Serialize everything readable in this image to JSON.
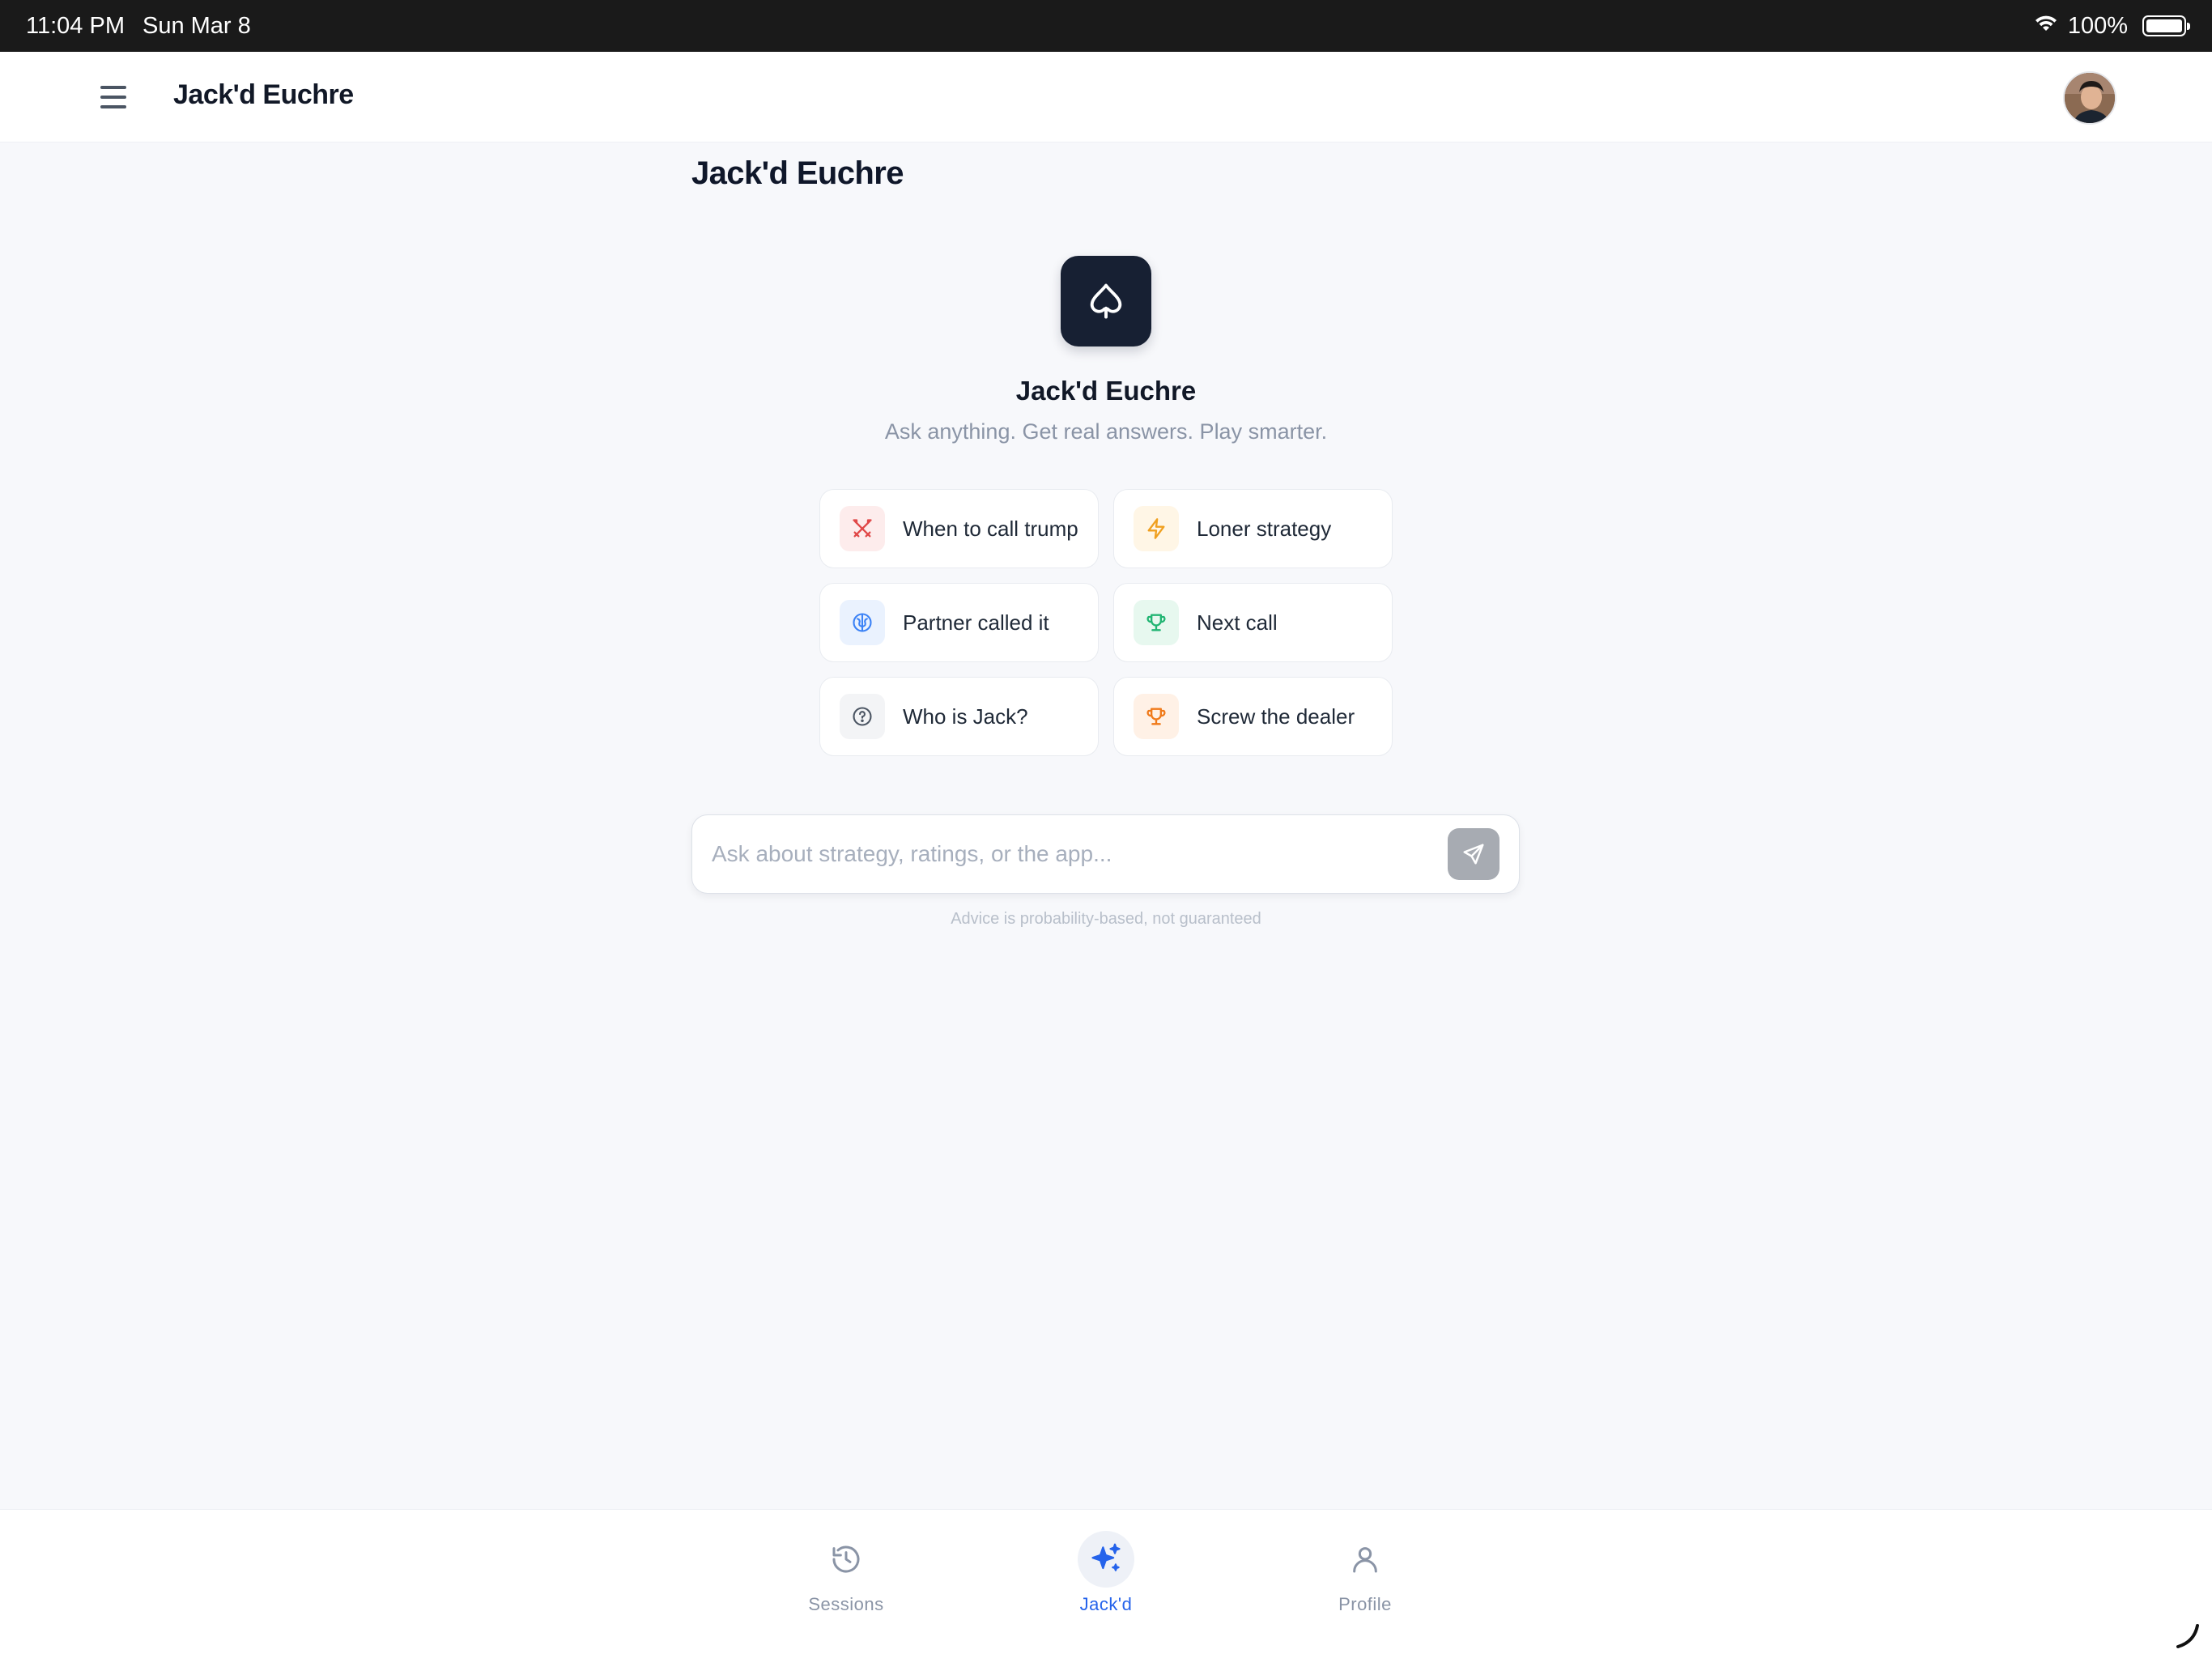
{
  "status_bar": {
    "time": "11:04 PM",
    "date": "Sun Mar 8",
    "battery": "100%",
    "battery_level": 1.0
  },
  "app_bar": {
    "title": "Jack'd Euchre",
    "menu_icon": "hamburger-menu-icon",
    "avatar_icon": "user-avatar"
  },
  "main": {
    "heading": "Jack'd Euchre",
    "hero": {
      "icon": "spade-icon",
      "title": "Jack'd Euchre",
      "subtitle": "Ask anything. Get real answers. Play smarter."
    },
    "prompts": [
      {
        "label": "When to call trump",
        "icon": "crossed-swords-icon",
        "color": "#e04848",
        "bg": "#fdecec"
      },
      {
        "label": "Loner strategy",
        "icon": "lightning-icon",
        "color": "#f0a020",
        "bg": "#fff6e6"
      },
      {
        "label": "Partner called it",
        "icon": "brain-icon",
        "color": "#3b82f6",
        "bg": "#eaf2fe"
      },
      {
        "label": "Next call",
        "icon": "trophy-icon",
        "color": "#22b573",
        "bg": "#e7f8ef"
      },
      {
        "label": "Who is Jack?",
        "icon": "question-circle-icon",
        "color": "#4b5563",
        "bg": "#f3f4f6"
      },
      {
        "label": "Screw the dealer",
        "icon": "trophy-icon",
        "color": "#f07a1a",
        "bg": "#fff1e6"
      }
    ],
    "input": {
      "placeholder": "Ask about strategy, ratings, or the app...",
      "value": "",
      "send_icon": "send-icon"
    },
    "disclaimer": "Advice is probability-based, not guaranteed"
  },
  "bottom_nav": {
    "items": [
      {
        "label": "Sessions",
        "icon": "history-icon",
        "active": false
      },
      {
        "label": "Jack'd",
        "icon": "sparkles-icon",
        "active": true
      },
      {
        "label": "Profile",
        "icon": "user-icon",
        "active": false
      }
    ]
  },
  "colors": {
    "accent": "#2563eb",
    "dark_tile": "#172033",
    "background": "#f7f8fb"
  }
}
